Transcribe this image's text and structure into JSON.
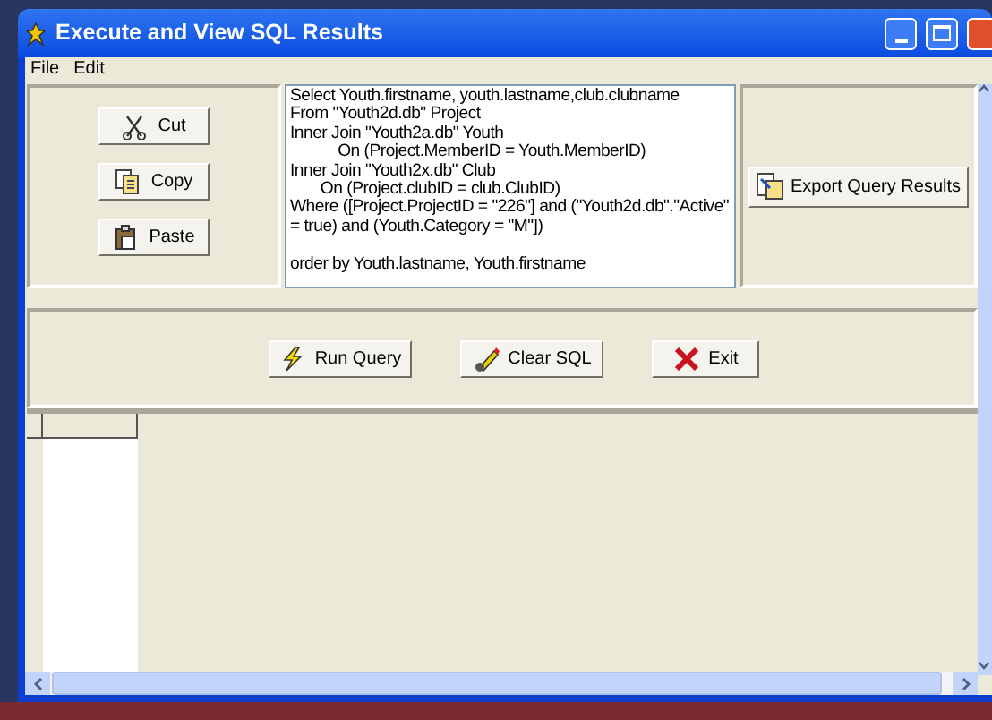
{
  "window": {
    "title": "Execute and View SQL Results"
  },
  "menu": [
    "File",
    "Edit"
  ],
  "edit_buttons": [
    {
      "label": "Cut",
      "kind": "cut"
    },
    {
      "label": "Copy",
      "kind": "copy"
    },
    {
      "label": "Paste",
      "kind": "paste"
    }
  ],
  "sql": "Select Youth.firstname, youth.lastname,club.clubname\nFrom \"Youth2d.db\" Project\nInner Join \"Youth2a.db\" Youth\n           On (Project.MemberID = Youth.MemberID)\nInner Join \"Youth2x.db\" Club\n       On (Project.clubID = club.ClubID)\nWhere ([Project.ProjectID = \"226\"] and (\"Youth2d.db\".\"Active\"\n= true) and (Youth.Category = \"M\"])\n\norder by Youth.lastname, Youth.firstname",
  "export_button": {
    "label": "Export Query Results"
  },
  "action_buttons": [
    {
      "label": "Run Query",
      "kind": "run"
    },
    {
      "label": "Clear SQL",
      "kind": "clear"
    },
    {
      "label": "Exit",
      "kind": "exit"
    }
  ]
}
